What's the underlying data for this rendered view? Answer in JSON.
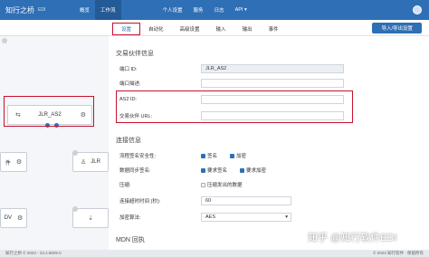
{
  "topbar": {
    "logo": "知行之桥",
    "logo_sub": "EDI",
    "nav": [
      "概览",
      "工作流"
    ],
    "nav2": [
      "个人设置",
      "服务",
      "日志",
      "API ▾"
    ]
  },
  "canvas": {
    "main_node": "JLR_AS2",
    "node_a_suffix": "件",
    "node_b": "JLR",
    "node_c_prefix": "DV"
  },
  "panel": {
    "tabs": [
      "设置",
      "自动化",
      "高级设置",
      "输入",
      "输出",
      "事件"
    ],
    "action_button": "导入/导出设置",
    "section_partner": "交易伙伴信息",
    "port_id_label": "端口 ID:",
    "port_id_value": "JLR_AS2",
    "port_desc_label": "端口描述:",
    "as2_id_label": "AS2 ID:",
    "as2_id_value": "",
    "partner_url_label": "交易伙伴 URL:",
    "partner_url_value": "",
    "section_connection": "连接信息",
    "incoming_security_label": "流程签名安全性:",
    "incoming_opts": [
      "签名",
      "加密"
    ],
    "receipt_security_label": "数据同步签名:",
    "receipt_opts": [
      "要求签名",
      "要求加密"
    ],
    "compress_label": "压缩:",
    "compress_opt": "压缩发出的数据",
    "timeout_label": "连接超时时间 (秒):",
    "timeout_value": "60",
    "encrypt_label": "加密算法:",
    "encrypt_value": "AES",
    "section_mdn": "MDN 回执"
  },
  "footer": {
    "left": "知行之桥 © 2023 - 23.2.8609.0",
    "right": "© 2023 知行软件 · 保留所有"
  },
  "watermark": "知乎 @知行软件EDI"
}
